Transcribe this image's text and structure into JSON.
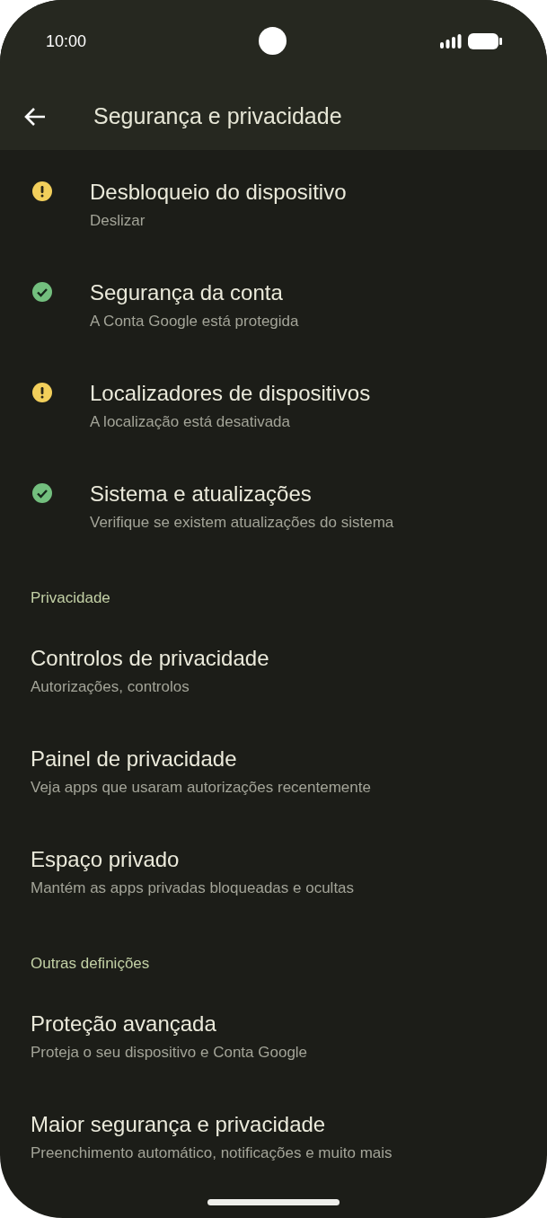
{
  "status_bar": {
    "time": "10:00"
  },
  "header": {
    "title": "Segurança e privacidade"
  },
  "sections": [
    {
      "items": [
        {
          "kind": "status",
          "warning": true,
          "title": "Desbloqueio do dispositivo",
          "subtitle": "Deslizar"
        },
        {
          "kind": "status",
          "warning": false,
          "title": "Segurança da conta",
          "subtitle": "A Conta Google está protegida"
        },
        {
          "kind": "status",
          "warning": true,
          "title": "Localizadores de dispositivos",
          "subtitle": "A localização está desativada"
        },
        {
          "kind": "status",
          "warning": false,
          "title": "Sistema e atualizações",
          "subtitle": "Verifique se existem atualizações do sistema"
        }
      ]
    },
    {
      "heading": "Privacidade",
      "items": [
        {
          "kind": "plain",
          "title": "Controlos de privacidade",
          "subtitle": "Autorizações, controlos"
        },
        {
          "kind": "plain",
          "title": "Painel de privacidade",
          "subtitle": "Veja apps que usaram autorizações recentemente"
        },
        {
          "kind": "plain",
          "title": "Espaço privado",
          "subtitle": "Mantém as apps privadas bloqueadas e ocultas"
        }
      ]
    },
    {
      "heading": "Outras definições",
      "items": [
        {
          "kind": "plain",
          "title": "Proteção avançada",
          "subtitle": "Proteja o seu dispositivo e Conta Google"
        },
        {
          "kind": "plain",
          "title": "Maior segurança e privacidade",
          "subtitle": "Preenchimento automático, notificações e muito mais"
        }
      ]
    }
  ]
}
